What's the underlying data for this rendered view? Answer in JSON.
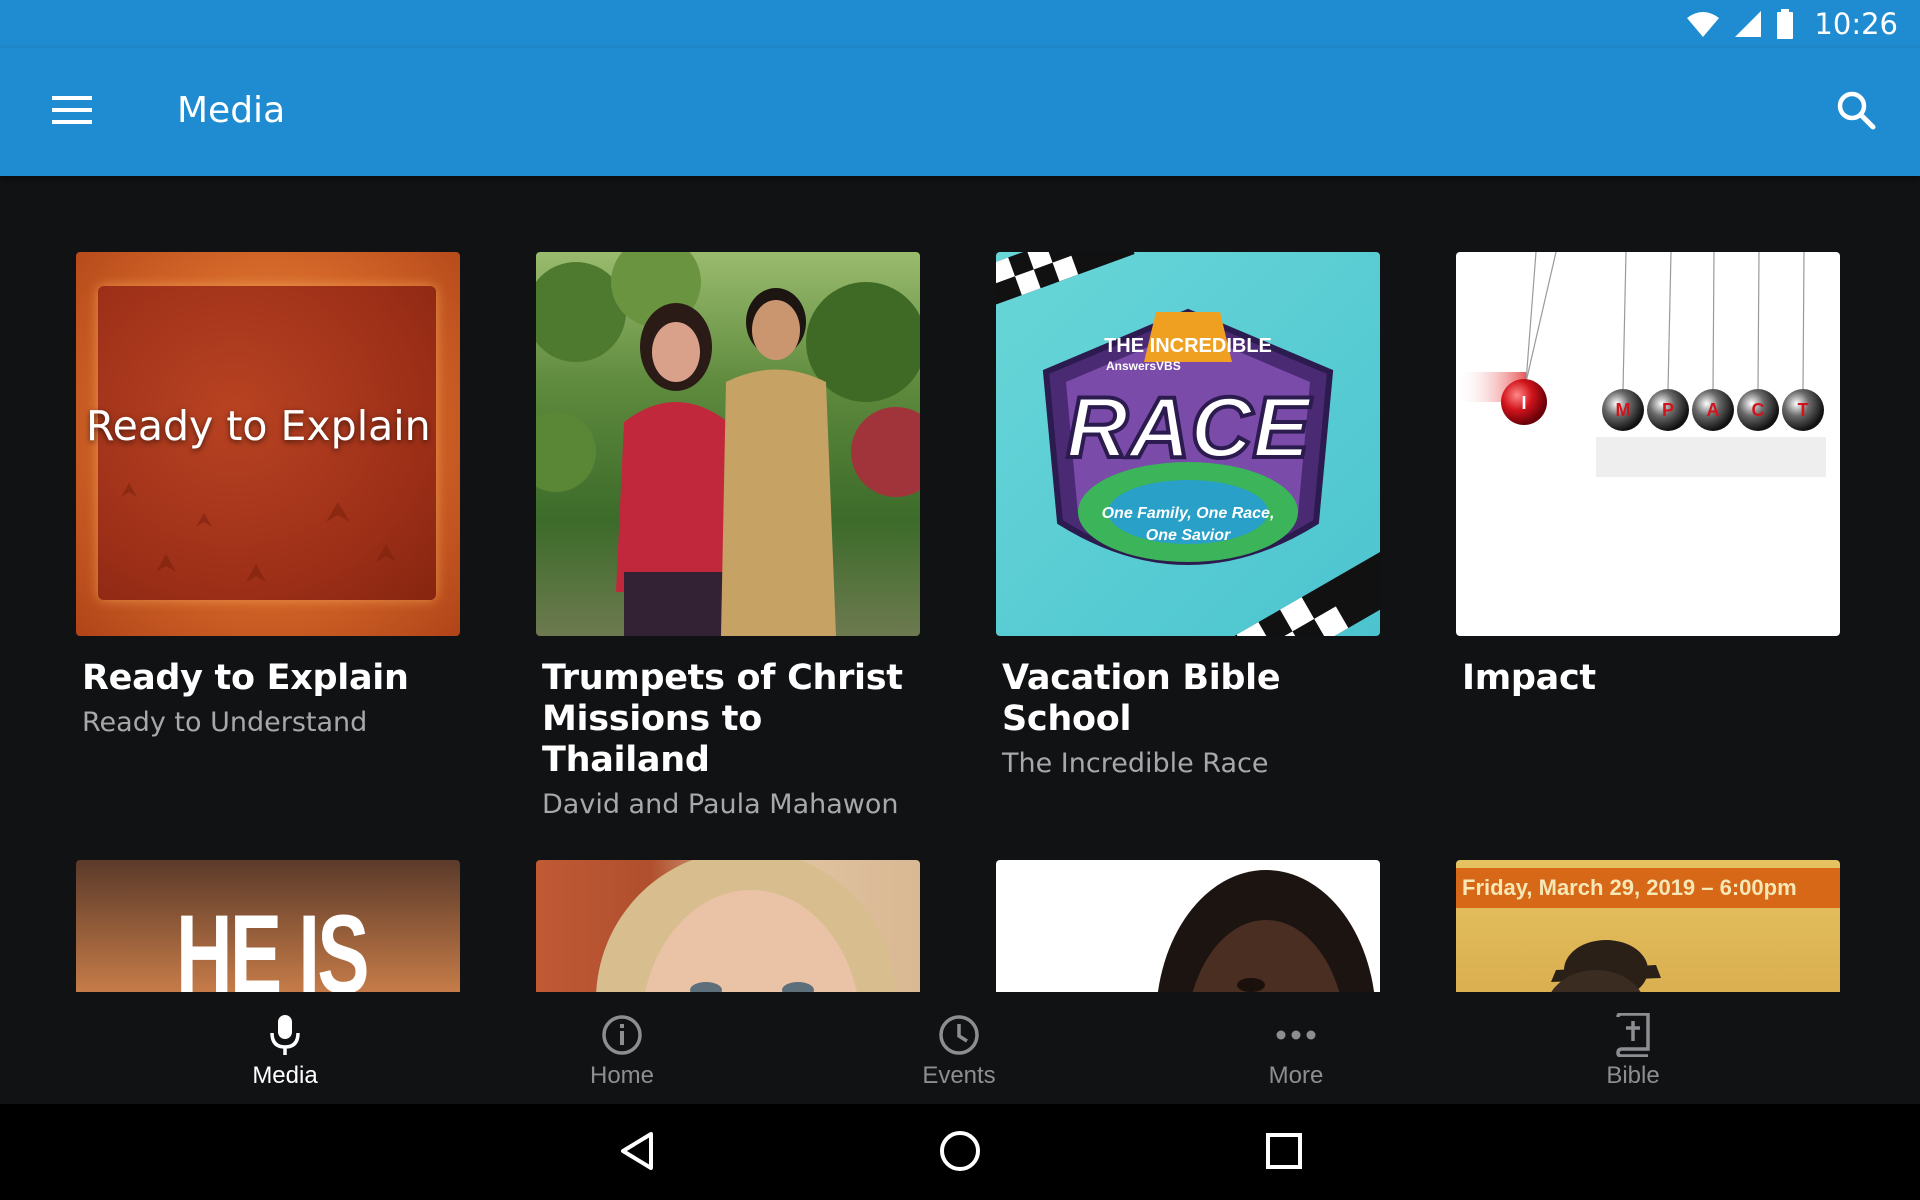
{
  "status_bar": {
    "time": "10:26",
    "icons": [
      "wifi-icon",
      "cell-signal-icon",
      "battery-icon"
    ]
  },
  "app_bar": {
    "title": "Media",
    "icons": [
      "menu-icon",
      "search-icon"
    ],
    "color": "#1f8bd0"
  },
  "cards": [
    {
      "title": "Ready to Explain",
      "subtitle": "Ready to Understand",
      "thumb_text": "Ready to Explain"
    },
    {
      "title": "Trumpets of Christ Missions to Thailand",
      "subtitle": "David and Paula Mahawon"
    },
    {
      "title": "Vacation Bible School",
      "subtitle": "The Incredible Race",
      "thumb_text": {
        "brand": "AnswersVBS",
        "top": "THE INCREDIBLE",
        "main": "RACE",
        "tagline_1": "One Family, One Race,",
        "tagline_2": "One Savior"
      }
    },
    {
      "title": "Impact",
      "subtitle": "",
      "thumb_text": [
        "I",
        "M",
        "P",
        "A",
        "C",
        "T"
      ]
    },
    {
      "thumb_text": "HE IS"
    },
    {},
    {},
    {
      "thumb_text": "Friday, March 29, 2019 – 6:00pm"
    }
  ],
  "bottom_nav": [
    {
      "label": "Media",
      "icon": "microphone-icon",
      "active": true
    },
    {
      "label": "Home",
      "icon": "info-icon",
      "active": false
    },
    {
      "label": "Events",
      "icon": "clock-icon",
      "active": false
    },
    {
      "label": "More",
      "icon": "more-dots-icon",
      "active": false
    },
    {
      "label": "Bible",
      "icon": "bible-icon",
      "active": false
    }
  ],
  "system_nav": [
    "back-icon",
    "home-icon",
    "recents-icon"
  ],
  "colors": {
    "accent": "#1f8bd0",
    "background": "#111214",
    "subtitle": "#a6a8ab",
    "nav_inactive": "#8c8e91"
  }
}
